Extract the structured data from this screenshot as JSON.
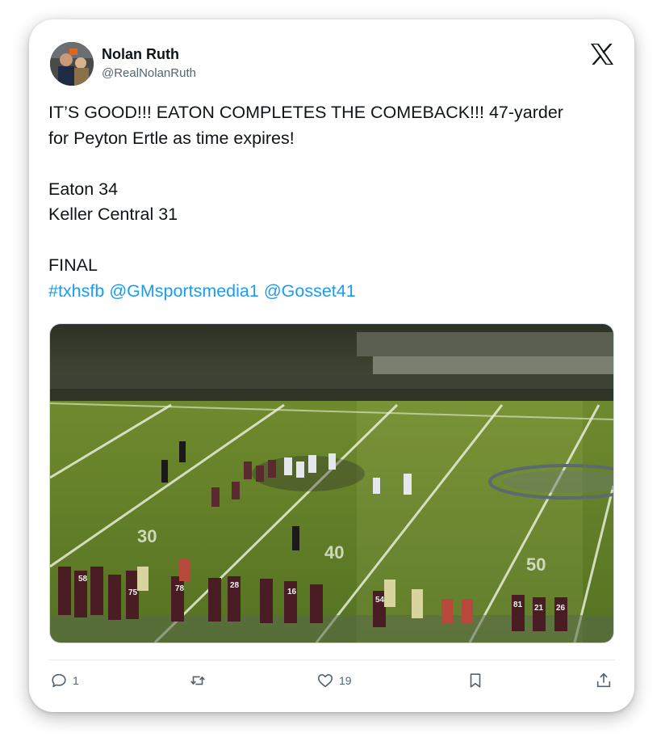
{
  "author": {
    "name": "Nolan Ruth",
    "handle": "@RealNolanRuth"
  },
  "tweet": {
    "lines": [
      "IT’S GOOD!!! EATON COMPLETES THE COMEBACK!!! 47-yarder",
      "for Peyton Ertle as time expires!",
      "",
      "Eaton 34",
      "Keller Central 31",
      "",
      "FINAL"
    ],
    "links": [
      "#txhsfb",
      "@GMsportsmedia1",
      "@Gosset41"
    ]
  },
  "media": {
    "yard_markers": [
      "30",
      "40",
      "50"
    ],
    "jersey_numbers": [
      "78",
      "58",
      "75",
      "28",
      "16",
      "54",
      "81",
      "21",
      "26"
    ]
  },
  "actions": {
    "reply_count": "1",
    "retweet_count": "",
    "like_count": "19"
  },
  "colors": {
    "link": "#1d9bf0",
    "icon": "#536471",
    "text": "#0f1419"
  }
}
